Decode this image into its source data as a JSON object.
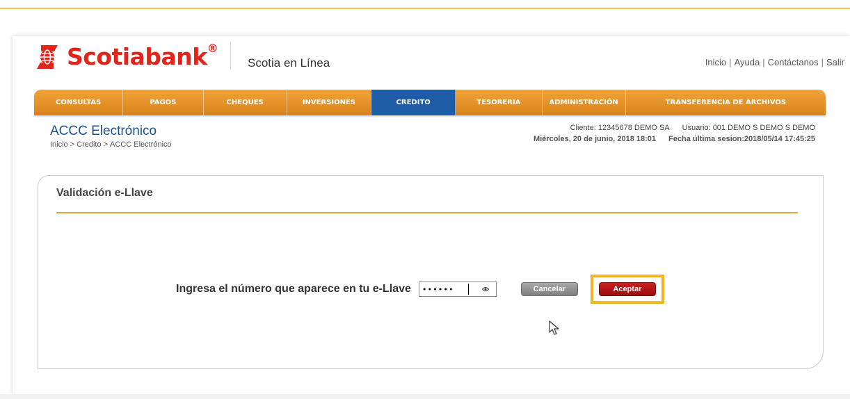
{
  "colors": {
    "brand_red": "#e1251b",
    "nav_orange": "#e8951f",
    "nav_active_blue": "#1f5ca8",
    "highlight_yellow": "#f2b420"
  },
  "brand": {
    "name": "Scotiabank",
    "trademark": "®",
    "app_name": "Scotia en Línea",
    "logo_icon": "scotiabank-globe-icon"
  },
  "top_links": [
    "Inicio",
    "Ayuda",
    "Contáctanos",
    "Salir"
  ],
  "top_links_separator": "|",
  "nav": {
    "tabs": [
      "CONSULTAS",
      "PAGOS",
      "CHEQUES",
      "INVERSIONES",
      "CREDITO",
      "TESORERIA",
      "ADMINISTRACIÓN",
      "TRANSFERENCIA DE ARCHIVOS"
    ],
    "active": "CREDITO"
  },
  "page": {
    "title": "ACCC Electrónico",
    "breadcrumb": [
      "Inicio",
      "Credito",
      "ACCC Electrónico"
    ],
    "breadcrumb_separator": ">"
  },
  "session": {
    "client": "Cliente: 12345678  DEMO SA",
    "user": "Usuario: 001 DEMO S DEMO S DEMO",
    "datetime": "Miércoles, 20 de junio, 2018 18:01",
    "last_session": "Fecha última sesion:2018/05/14 17:45:25"
  },
  "panel": {
    "title": "Validación e-Llave",
    "prompt": "Ingresa el número que aparece en tu e-Llave",
    "pin_value": "••••••",
    "reveal_icon": "eye-icon",
    "cancel_label": "Cancelar",
    "accept_label": "Aceptar"
  },
  "cursor_icon": "mouse-pointer-icon"
}
